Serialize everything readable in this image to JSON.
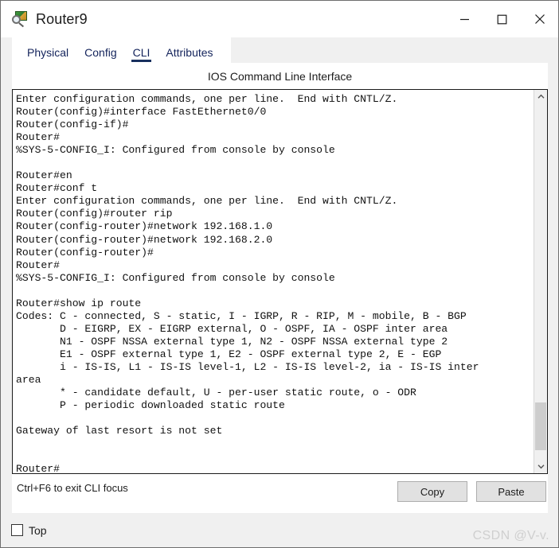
{
  "window": {
    "title": "Router9",
    "icon": "router-magnifier-icon",
    "controls": {
      "minimize": "minimize-icon",
      "maximize": "maximize-icon",
      "close": "close-icon"
    }
  },
  "tabs": [
    {
      "label": "Physical",
      "active": false
    },
    {
      "label": "Config",
      "active": false
    },
    {
      "label": "CLI",
      "active": true
    },
    {
      "label": "Attributes",
      "active": false
    }
  ],
  "panel": {
    "title": "IOS Command Line Interface"
  },
  "terminal": {
    "text": "Enter configuration commands, one per line.  End with CNTL/Z.\nRouter(config)#interface FastEthernet0/0\nRouter(config-if)#\nRouter#\n%SYS-5-CONFIG_I: Configured from console by console\n\nRouter#en\nRouter#conf t\nEnter configuration commands, one per line.  End with CNTL/Z.\nRouter(config)#router rip\nRouter(config-router)#network 192.168.1.0\nRouter(config-router)#network 192.168.2.0\nRouter(config-router)#\nRouter#\n%SYS-5-CONFIG_I: Configured from console by console\n\nRouter#show ip route\nCodes: C - connected, S - static, I - IGRP, R - RIP, M - mobile, B - BGP\n       D - EIGRP, EX - EIGRP external, O - OSPF, IA - OSPF inter area\n       N1 - OSPF NSSA external type 1, N2 - OSPF NSSA external type 2\n       E1 - OSPF external type 1, E2 - OSPF external type 2, E - EGP\n       i - IS-IS, L1 - IS-IS level-1, L2 - IS-IS level-2, ia - IS-IS inter\narea\n       * - candidate default, U - per-user static route, o - ODR\n       P - periodic downloaded static route\n\nGateway of last resort is not set\n\n\nRouter#"
  },
  "scrollbar": {
    "up_arrow": "chevron-up-icon",
    "down_arrow": "chevron-down-icon"
  },
  "footer": {
    "hint": "Ctrl+F6 to exit CLI focus",
    "copy_label": "Copy",
    "paste_label": "Paste"
  },
  "status": {
    "top_checkbox_label": "Top",
    "top_checked": false,
    "watermark": "CSDN @V-v."
  }
}
